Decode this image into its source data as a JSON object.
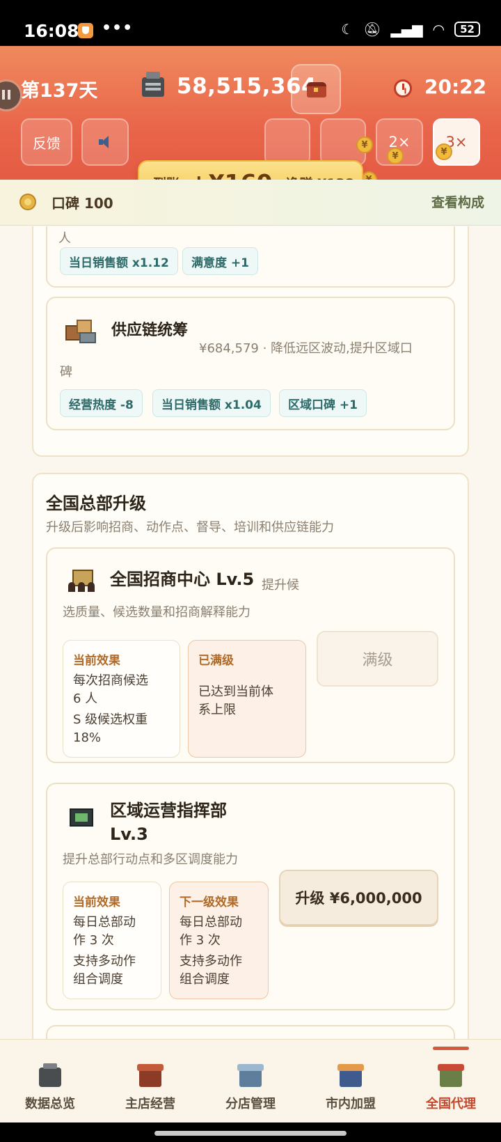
{
  "status_bar": {
    "time": "16:08",
    "dots": "•••",
    "battery": "52",
    "icons": [
      "moon-icon",
      "mute-icon",
      "signal-icon",
      "wifi-icon",
      "battery-icon"
    ]
  },
  "header": {
    "day": "第137天",
    "money": "58,515,364",
    "clock": "20:22",
    "buttons": {
      "feedback": "反馈",
      "speed2": "2×",
      "speed3": "3×"
    },
    "coin_symbol": "¥",
    "toast": {
      "label": "到账",
      "amount": "+¥160",
      "net": "净赚 ¥138"
    }
  },
  "reputation": {
    "label": "口碑 100",
    "link": "查看构成"
  },
  "prev_card": {
    "clipped_text": "人",
    "chips": [
      "当日销售额 x1.12",
      "满意度 +1"
    ]
  },
  "supply_chain": {
    "name": "供应链统筹",
    "cost_desc": "¥684,579 · 降低远区波动,提升区域口",
    "desc_wrap": "碑",
    "chips": [
      "经营热度 -8",
      "当日销售额 x1.04",
      "区域口碑 +1"
    ]
  },
  "hq": {
    "title": "全国总部升级",
    "subtitle": "升级后影响招商、动作点、督导、培训和供应链能力",
    "upgrades": [
      {
        "name": "全国招商中心 Lv.5",
        "desc_inline": "提升候",
        "desc": "选质量、候选数量和招商解释能力",
        "current_title": "当前效果",
        "current_lines": [
          "每次招商候选\n6 人",
          "S 级候选权重\n18%"
        ],
        "next_title": "已满级",
        "next_lines": [
          "已达到当前体\n系上限"
        ],
        "button": "满级"
      },
      {
        "name_line1": "区域运营指挥部",
        "name_line2": "Lv.3",
        "desc": "提升总部行动点和多区调度能力",
        "current_title": "当前效果",
        "current_lines": [
          "每日总部动\n作 3 次",
          "支持多动作\n组合调度"
        ],
        "next_title": "下一级效果",
        "next_lines": [
          "每日总部动\n作 3 次",
          "支持多动作\n组合调度"
        ],
        "button": "升级 ¥6,000,000"
      }
    ]
  },
  "bottom_nav": {
    "items": [
      {
        "label": "数据总览",
        "icon": "cash-register-icon"
      },
      {
        "label": "主店经营",
        "icon": "main-store-icon"
      },
      {
        "label": "分店管理",
        "icon": "branch-store-icon"
      },
      {
        "label": "市内加盟",
        "icon": "city-franchise-icon"
      },
      {
        "label": "全国代理",
        "icon": "national-agency-icon"
      }
    ],
    "active_index": 4,
    "active_color": "#c3472c"
  },
  "colors": {
    "header_gradient_start": "#ef8a5e",
    "header_gradient_end": "#e45b43",
    "toast_gold": "#f6c552",
    "chip_teal": "#2d6a6a",
    "effect_title": "#b06a28"
  }
}
